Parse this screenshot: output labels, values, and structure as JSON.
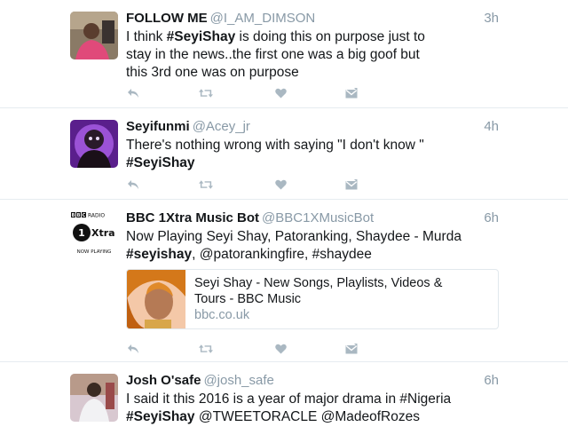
{
  "tweets": [
    {
      "name": "FOLLOW ME",
      "handle": "@I_AM_DIMSON",
      "time": "3h",
      "lines": [
        [
          {
            "t": "I think "
          },
          {
            "t": "#SeyiShay",
            "b": true
          },
          {
            "t": " is doing this on purpose just to"
          }
        ],
        [
          {
            "t": "stay in the news..the first one was a big goof but"
          }
        ],
        [
          {
            "t": "this 3rd one was on purpose"
          }
        ]
      ]
    },
    {
      "name": "Seyifunmi",
      "handle": "@Acey_jr",
      "time": "4h",
      "lines": [
        [
          {
            "t": "There's nothing wrong with saying \"I don't know \""
          }
        ],
        [
          {
            "t": "#SeyiShay",
            "b": true
          }
        ]
      ]
    },
    {
      "name": "BBC 1Xtra Music Bot",
      "handle": "@BBC1XMusicBot",
      "time": "6h",
      "lines": [
        [
          {
            "t": "Now Playing Seyi Shay, Patoranking, Shaydee - Murda"
          }
        ],
        [
          {
            "t": "#seyishay",
            "b": true
          },
          {
            "t": ", @patorankingfire, #shaydee"
          }
        ]
      ],
      "logo": {
        "top": "BBC RADIO",
        "brand": "1Xtra",
        "bottom": "NOW PLAYING"
      },
      "card": {
        "title_line1": "Seyi Shay - New Songs, Playlists, Videos &",
        "title_line2": "Tours - BBC Music",
        "domain": "bbc.co.uk"
      }
    },
    {
      "name": "Josh O'safe",
      "handle": "@josh_safe",
      "time": "6h",
      "lines": [
        [
          {
            "t": "I said it this 2016 is a year of major drama in #Nigeria"
          }
        ],
        [
          {
            "t": "#SeyiShay",
            "b": true
          },
          {
            "t": " @TWEETORACLE @MadeofRozes @OpeCole"
          }
        ]
      ]
    }
  ],
  "icons": [
    "reply-icon",
    "retweet-icon",
    "like-icon",
    "dm-icon"
  ],
  "colors": {
    "icon": "#aab8c2",
    "secondary": "#8899a6",
    "text": "#14171a",
    "divider": "#e6ecf0"
  }
}
